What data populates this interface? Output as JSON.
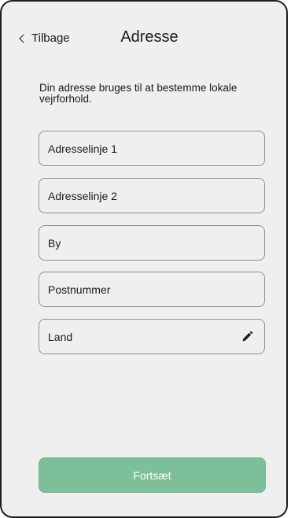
{
  "header": {
    "back_label": "Tilbage",
    "title": "Adresse"
  },
  "description": "Din adresse bruges til at bestemme lokale vejrforhold.",
  "fields": [
    {
      "label": "Adresselinje 1"
    },
    {
      "label": "Adresselinje 2"
    },
    {
      "label": "By"
    },
    {
      "label": "Postnummer"
    },
    {
      "label": "Land",
      "icon": "pencil-icon"
    }
  ],
  "footer": {
    "continue_label": "Fortsæt",
    "continue_color": "#7dbf9a"
  }
}
